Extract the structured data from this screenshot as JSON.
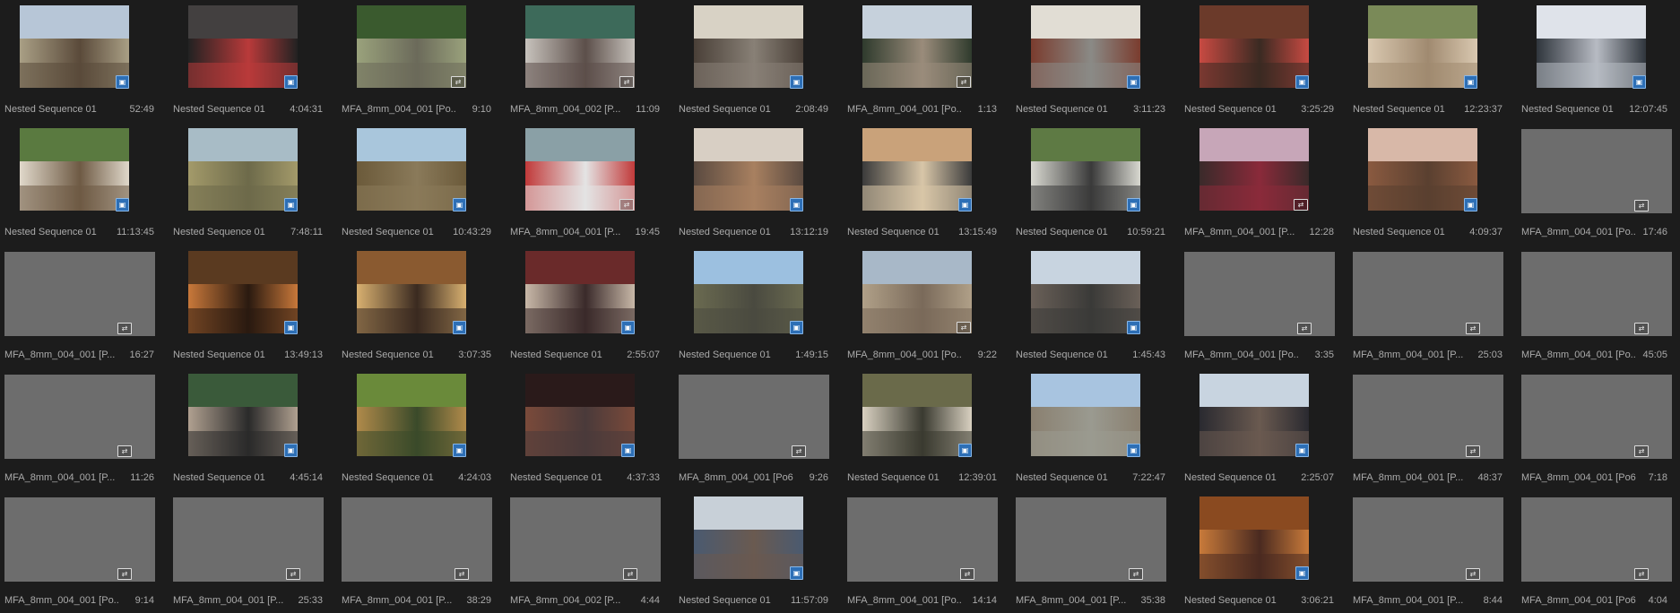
{
  "app": "Project Panel - Icon View",
  "colors": {
    "background": "#1c1c1c",
    "placeholder": "#6d6d6d",
    "label_text": "#aaaaaa",
    "nested_badge": "#2d6fb6"
  },
  "badges": {
    "nested_icon": "nested-sequence-icon",
    "clip_icon": "video-clip-icon"
  },
  "clips": [
    {
      "name": "Nested Sequence 01",
      "duration": "52:49",
      "kind": "nested",
      "thumb": "photo",
      "palette": [
        "#b7c6d7",
        "#a99f85",
        "#5a4a3a"
      ]
    },
    {
      "name": "Nested Sequence 01",
      "duration": "4:04:31",
      "kind": "nested",
      "thumb": "photo",
      "palette": [
        "#434040",
        "#222222",
        "#b93a3a"
      ]
    },
    {
      "name": "MFA_8mm_004_001 [Po...",
      "duration": "9:10",
      "kind": "clip",
      "thumb": "photo",
      "palette": [
        "#3a5a2e",
        "#9aa27c",
        "#6b6a5a"
      ]
    },
    {
      "name": "MFA_8mm_004_002 [P...",
      "duration": "11:09",
      "kind": "clip",
      "thumb": "photo",
      "palette": [
        "#3d6a5a",
        "#c7c2bc",
        "#5c4f4a"
      ]
    },
    {
      "name": "Nested Sequence 01",
      "duration": "2:08:49",
      "kind": "nested",
      "thumb": "photo",
      "palette": [
        "#d8d2c5",
        "#4a4038",
        "#888076"
      ]
    },
    {
      "name": "MFA_8mm_004_001 [Po...",
      "duration": "1:13",
      "kind": "clip",
      "thumb": "photo",
      "palette": [
        "#c6d1dc",
        "#2f3b2d",
        "#9a8c7b"
      ]
    },
    {
      "name": "Nested Sequence 01",
      "duration": "3:11:23",
      "kind": "nested",
      "thumb": "photo",
      "palette": [
        "#e1ddd4",
        "#7a3c2e",
        "#8a8a86"
      ]
    },
    {
      "name": "Nested Sequence 01",
      "duration": "3:25:29",
      "kind": "nested",
      "thumb": "photo",
      "palette": [
        "#6b3a2a",
        "#c84a42",
        "#3a2a22"
      ]
    },
    {
      "name": "Nested Sequence 01",
      "duration": "12:23:37",
      "kind": "nested",
      "thumb": "photo",
      "palette": [
        "#7a8a58",
        "#d9c8b0",
        "#a08a70"
      ]
    },
    {
      "name": "Nested Sequence 01",
      "duration": "12:07:45",
      "kind": "nested",
      "thumb": "photo",
      "palette": [
        "#dfe3ea",
        "#30363d",
        "#b7bbc3"
      ]
    },
    {
      "name": "Nested Sequence 01",
      "duration": "11:13:45",
      "kind": "nested",
      "thumb": "photo",
      "palette": [
        "#5a7a40",
        "#e0d8ca",
        "#6e5a44"
      ]
    },
    {
      "name": "Nested Sequence 01",
      "duration": "7:48:11",
      "kind": "nested",
      "thumb": "photo",
      "palette": [
        "#a8bcc6",
        "#a39a6a",
        "#6d6a4a"
      ]
    },
    {
      "name": "Nested Sequence 01",
      "duration": "10:43:29",
      "kind": "nested",
      "thumb": "photo",
      "palette": [
        "#a9c6dc",
        "#6b5a3a",
        "#8a7a5a"
      ]
    },
    {
      "name": "MFA_8mm_004_001 [P...",
      "duration": "19:45",
      "kind": "clip",
      "thumb": "photo",
      "palette": [
        "#8aa0a6",
        "#c13a3a",
        "#e4e4e4"
      ]
    },
    {
      "name": "Nested Sequence 01",
      "duration": "13:12:19",
      "kind": "nested",
      "thumb": "photo",
      "palette": [
        "#d8cfc4",
        "#5a4a40",
        "#a88060"
      ]
    },
    {
      "name": "Nested Sequence 01",
      "duration": "13:15:49",
      "kind": "nested",
      "thumb": "photo",
      "palette": [
        "#c9a27a",
        "#3b3b3b",
        "#d8c6a8"
      ]
    },
    {
      "name": "Nested Sequence 01",
      "duration": "10:59:21",
      "kind": "nested",
      "thumb": "photo",
      "palette": [
        "#5e7a44",
        "#d8d8d0",
        "#3a3a3a"
      ]
    },
    {
      "name": "MFA_8mm_004_001 [P...",
      "duration": "12:28",
      "kind": "clip",
      "thumb": "photo",
      "palette": [
        "#c7a6b8",
        "#3a2a2a",
        "#8a2a3a"
      ]
    },
    {
      "name": "Nested Sequence 01",
      "duration": "4:09:37",
      "kind": "nested",
      "thumb": "photo",
      "palette": [
        "#d8b8a8",
        "#8a5a40",
        "#5a4030"
      ]
    },
    {
      "name": "MFA_8mm_004_001 [Po...",
      "duration": "17:46",
      "kind": "clip",
      "thumb": "placeholder",
      "palette": []
    },
    {
      "name": "MFA_8mm_004_001 [P...",
      "duration": "16:27",
      "kind": "clip",
      "thumb": "placeholder",
      "palette": []
    },
    {
      "name": "Nested Sequence 01",
      "duration": "13:49:13",
      "kind": "nested",
      "thumb": "photo",
      "palette": [
        "#5a3a20",
        "#c8783a",
        "#2a1a10"
      ]
    },
    {
      "name": "Nested Sequence 01",
      "duration": "3:07:35",
      "kind": "nested",
      "thumb": "photo",
      "palette": [
        "#8a5a30",
        "#d8b070",
        "#3a2a20"
      ]
    },
    {
      "name": "Nested Sequence 01",
      "duration": "2:55:07",
      "kind": "nested",
      "thumb": "photo",
      "palette": [
        "#6a2a2a",
        "#c8b8a8",
        "#3a2a2a"
      ]
    },
    {
      "name": "Nested Sequence 01",
      "duration": "1:49:15",
      "kind": "nested",
      "thumb": "photo",
      "palette": [
        "#9cc0e0",
        "#6a6a50",
        "#4a4a40"
      ]
    },
    {
      "name": "MFA_8mm_004_001 [Po...",
      "duration": "9:22",
      "kind": "clip",
      "thumb": "photo",
      "palette": [
        "#a8b8c8",
        "#b0a088",
        "#7a6a5a"
      ]
    },
    {
      "name": "Nested Sequence 01",
      "duration": "1:45:43",
      "kind": "nested",
      "thumb": "photo",
      "palette": [
        "#c8d4e0",
        "#6a6058",
        "#3a3a38"
      ]
    },
    {
      "name": "MFA_8mm_004_001 [Po...",
      "duration": "3:35",
      "kind": "clip",
      "thumb": "placeholder",
      "palette": []
    },
    {
      "name": "MFA_8mm_004_001 [P...",
      "duration": "25:03",
      "kind": "clip",
      "thumb": "placeholder",
      "palette": []
    },
    {
      "name": "MFA_8mm_004_001 [Po...",
      "duration": "45:05",
      "kind": "clip",
      "thumb": "placeholder",
      "palette": []
    },
    {
      "name": "MFA_8mm_004_001 [P...",
      "duration": "11:26",
      "kind": "clip",
      "thumb": "placeholder",
      "palette": []
    },
    {
      "name": "Nested Sequence 01",
      "duration": "4:45:14",
      "kind": "nested",
      "thumb": "photo",
      "palette": [
        "#3a5a3a",
        "#b0a090",
        "#2a2a2a"
      ]
    },
    {
      "name": "Nested Sequence 01",
      "duration": "4:24:03",
      "kind": "nested",
      "thumb": "photo",
      "palette": [
        "#6a8a3a",
        "#b08a4a",
        "#3a4a2a"
      ]
    },
    {
      "name": "Nested Sequence 01",
      "duration": "4:37:33",
      "kind": "nested",
      "thumb": "photo",
      "palette": [
        "#2a1a1a",
        "#7a4a3a",
        "#4a3a3a"
      ]
    },
    {
      "name": "MFA_8mm_004_001 [Po6...",
      "duration": "9:26",
      "kind": "clip",
      "thumb": "placeholder",
      "palette": []
    },
    {
      "name": "Nested Sequence 01",
      "duration": "12:39:01",
      "kind": "nested",
      "thumb": "photo",
      "palette": [
        "#6a6a4a",
        "#d8d0c0",
        "#3a3a30"
      ]
    },
    {
      "name": "Nested Sequence 01",
      "duration": "7:22:47",
      "kind": "nested",
      "thumb": "photo",
      "palette": [
        "#a8c4e0",
        "#8a8070",
        "#9a9a90"
      ]
    },
    {
      "name": "Nested Sequence 01",
      "duration": "2:25:07",
      "kind": "nested",
      "thumb": "photo",
      "palette": [
        "#c8d4e0",
        "#2a2a30",
        "#6a5a50"
      ]
    },
    {
      "name": "MFA_8mm_004_001 [P...",
      "duration": "48:37",
      "kind": "clip",
      "thumb": "placeholder",
      "palette": []
    },
    {
      "name": "MFA_8mm_004_001 [Po6...",
      "duration": "7:18",
      "kind": "clip",
      "thumb": "placeholder",
      "palette": []
    },
    {
      "name": "MFA_8mm_004_001 [Po...",
      "duration": "9:14",
      "kind": "clip",
      "thumb": "placeholder",
      "palette": []
    },
    {
      "name": "MFA_8mm_004_001 [P...",
      "duration": "25:33",
      "kind": "clip",
      "thumb": "placeholder",
      "palette": []
    },
    {
      "name": "MFA_8mm_004_001 [P...",
      "duration": "38:29",
      "kind": "clip",
      "thumb": "placeholder",
      "palette": []
    },
    {
      "name": "MFA_8mm_004_002 [P...",
      "duration": "4:44",
      "kind": "clip",
      "thumb": "placeholder",
      "palette": []
    },
    {
      "name": "Nested Sequence 01",
      "duration": "11:57:09",
      "kind": "nested",
      "thumb": "photo",
      "palette": [
        "#c8d0d8",
        "#4a5a70",
        "#6a5a50"
      ]
    },
    {
      "name": "MFA_8mm_004_001 [Po...",
      "duration": "14:14",
      "kind": "clip",
      "thumb": "placeholder",
      "palette": []
    },
    {
      "name": "MFA_8mm_004_001 [P...",
      "duration": "35:38",
      "kind": "clip",
      "thumb": "placeholder",
      "palette": []
    },
    {
      "name": "Nested Sequence 01",
      "duration": "3:06:21",
      "kind": "nested",
      "thumb": "photo",
      "palette": [
        "#8a4a20",
        "#c87a3a",
        "#4a2a20"
      ]
    },
    {
      "name": "MFA_8mm_004_001 [P...",
      "duration": "8:44",
      "kind": "clip",
      "thumb": "placeholder",
      "palette": []
    },
    {
      "name": "MFA_8mm_004_001 [Po6...",
      "duration": "4:04",
      "kind": "clip",
      "thumb": "placeholder",
      "palette": []
    }
  ]
}
